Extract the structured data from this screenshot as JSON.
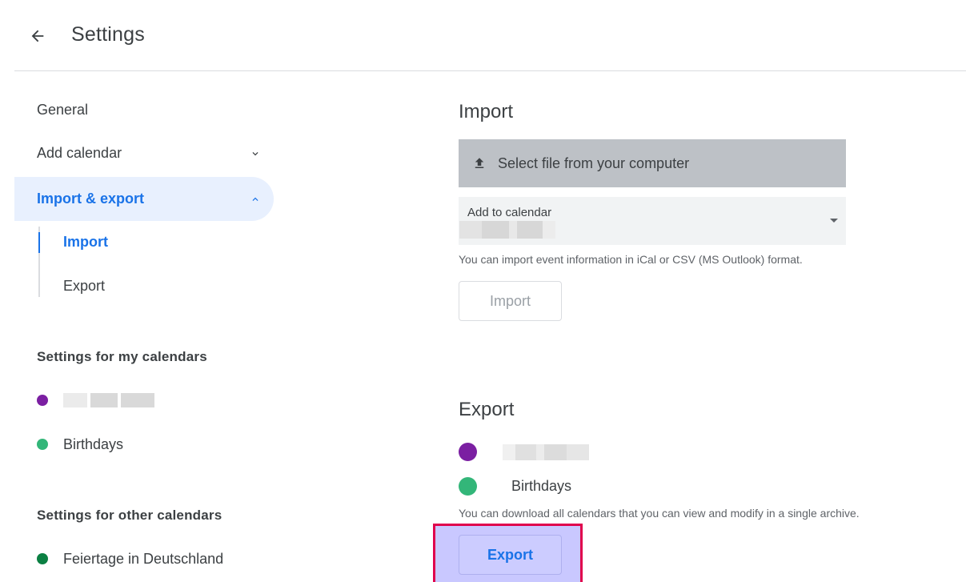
{
  "header": {
    "title": "Settings",
    "back_icon": "arrow-back-icon"
  },
  "sidebar": {
    "items": [
      {
        "label": "General"
      },
      {
        "label": "Add calendar",
        "icon": "chevron-down-icon"
      },
      {
        "label": "Import & export",
        "icon": "chevron-up-icon",
        "active": true
      }
    ],
    "sub_items": [
      {
        "label": "Import",
        "active": true
      },
      {
        "label": "Export"
      }
    ],
    "my_calendars": {
      "heading": "Settings for my calendars",
      "calendars": [
        {
          "label": "",
          "color": "#7b1fa2",
          "redacted": true
        },
        {
          "label": "Birthdays",
          "color": "#33b679"
        }
      ]
    },
    "other_calendars": {
      "heading": "Settings for other calendars",
      "calendars": [
        {
          "label": "Feiertage in Deutschland",
          "color": "#0b8043"
        }
      ]
    }
  },
  "import_section": {
    "title": "Import",
    "file_button": "Select file from your computer",
    "file_icon": "upload-icon",
    "select_label": "Add to calendar",
    "select_value_redacted": true,
    "hint": "You can import event information in iCal or CSV (MS Outlook) format.",
    "button": "Import"
  },
  "export_section": {
    "title": "Export",
    "calendars": [
      {
        "label": "",
        "color": "#7b1fa2",
        "redacted": true
      },
      {
        "label": "Birthdays",
        "color": "#33b679"
      }
    ],
    "hint": "You can download all calendars that you can view and modify in a single archive.",
    "button": "Export"
  },
  "colors": {
    "accent": "#1a73e8",
    "highlight": "#c9c8ff",
    "highlight_border": "#e0004d"
  }
}
